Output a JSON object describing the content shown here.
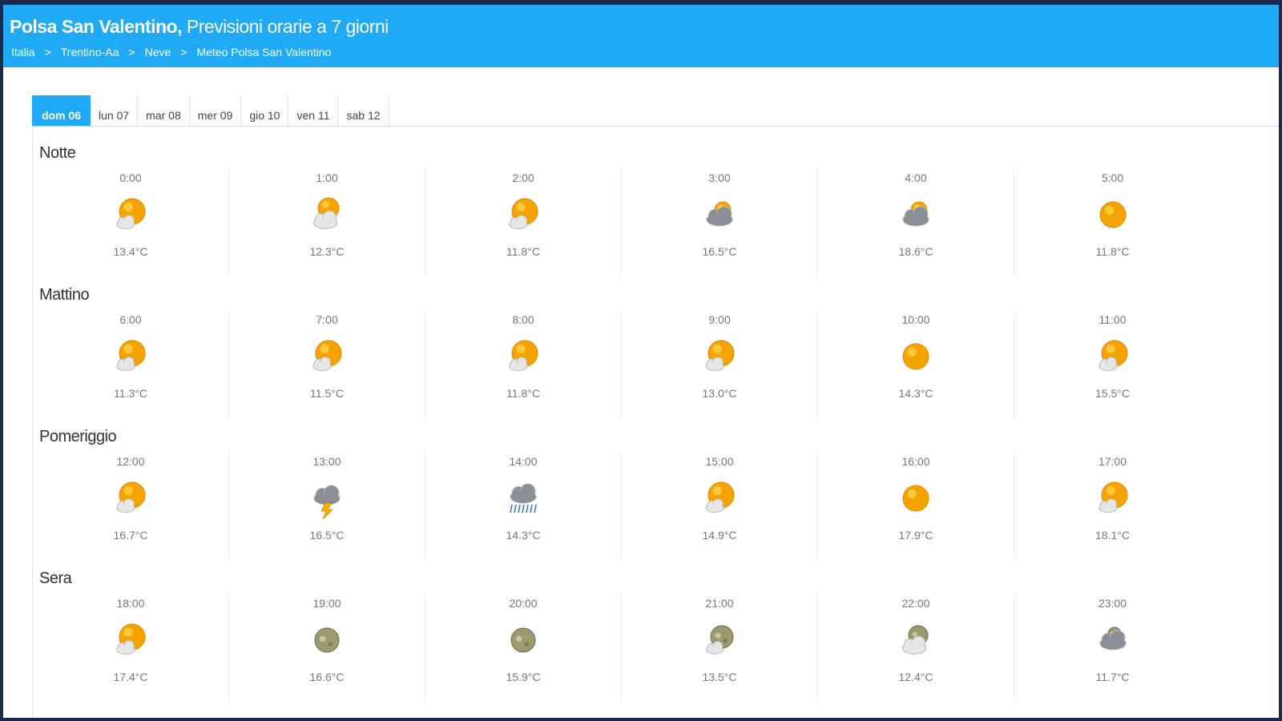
{
  "header": {
    "place": "Polsa San Valentino,",
    "subtitle": " Previsioni orarie a 7 giorni",
    "breadcrumb": [
      "Italia",
      "Trentino-Aa",
      "Neve",
      "Meteo Polsa San Valentino"
    ],
    "separator": ">"
  },
  "tabs": [
    {
      "label": "dom 06",
      "active": true
    },
    {
      "label": "lun 07",
      "active": false
    },
    {
      "label": "mar 08",
      "active": false
    },
    {
      "label": "mer 09",
      "active": false
    },
    {
      "label": "gio 10",
      "active": false
    },
    {
      "label": "ven 11",
      "active": false
    },
    {
      "label": "sab 12",
      "active": false
    }
  ],
  "colors": {
    "header_bg": "#20aaf6",
    "tab_active_bg": "#20aaf6",
    "sun": "#f5a300",
    "cloud": "#e6e6e6",
    "storm_cloud": "#8a8f96",
    "moon": "#9c9a6e"
  },
  "periods": [
    {
      "label": "Notte",
      "slots": [
        {
          "time": "0:00",
          "icon": "sun-cloud-icon",
          "temp": "13.4°C"
        },
        {
          "time": "1:00",
          "icon": "sun-clouds-icon",
          "temp": "12.3°C"
        },
        {
          "time": "2:00",
          "icon": "sun-cloud-icon",
          "temp": "11.8°C"
        },
        {
          "time": "3:00",
          "icon": "cloudy-sun-icon",
          "temp": "16.5°C"
        },
        {
          "time": "4:00",
          "icon": "cloudy-sun-icon",
          "temp": "18.6°C"
        },
        {
          "time": "5:00",
          "icon": "sun-icon",
          "temp": "11.8°C"
        }
      ]
    },
    {
      "label": "Mattino",
      "slots": [
        {
          "time": "6:00",
          "icon": "sun-cloud-icon",
          "temp": "11.3°C"
        },
        {
          "time": "7:00",
          "icon": "sun-cloud-icon",
          "temp": "11.5°C"
        },
        {
          "time": "8:00",
          "icon": "sun-cloud-icon",
          "temp": "11.8°C"
        },
        {
          "time": "9:00",
          "icon": "sun-cloud-icon",
          "temp": "13.0°C"
        },
        {
          "time": "10:00",
          "icon": "sun-icon",
          "temp": "14.3°C"
        },
        {
          "time": "11:00",
          "icon": "sun-cloud-icon",
          "temp": "15.5°C"
        }
      ]
    },
    {
      "label": "Pomeriggio",
      "slots": [
        {
          "time": "12:00",
          "icon": "sun-cloud-icon",
          "temp": "16.7°C"
        },
        {
          "time": "13:00",
          "icon": "thunderstorm-icon",
          "temp": "16.5°C"
        },
        {
          "time": "14:00",
          "icon": "heavy-rain-icon",
          "temp": "14.3°C"
        },
        {
          "time": "15:00",
          "icon": "sun-cloud-icon",
          "temp": "14.9°C"
        },
        {
          "time": "16:00",
          "icon": "sun-icon",
          "temp": "17.9°C"
        },
        {
          "time": "17:00",
          "icon": "sun-cloud-icon",
          "temp": "18.1°C"
        }
      ]
    },
    {
      "label": "Sera",
      "slots": [
        {
          "time": "18:00",
          "icon": "sun-cloud-icon",
          "temp": "17.4°C"
        },
        {
          "time": "19:00",
          "icon": "moon-icon",
          "temp": "16.6°C"
        },
        {
          "time": "20:00",
          "icon": "moon-icon",
          "temp": "15.9°C"
        },
        {
          "time": "21:00",
          "icon": "moon-cloud-icon",
          "temp": "13.5°C"
        },
        {
          "time": "22:00",
          "icon": "moon-clouds-icon",
          "temp": "12.4°C"
        },
        {
          "time": "23:00",
          "icon": "cloudy-moon-icon",
          "temp": "11.7°C"
        }
      ]
    }
  ]
}
